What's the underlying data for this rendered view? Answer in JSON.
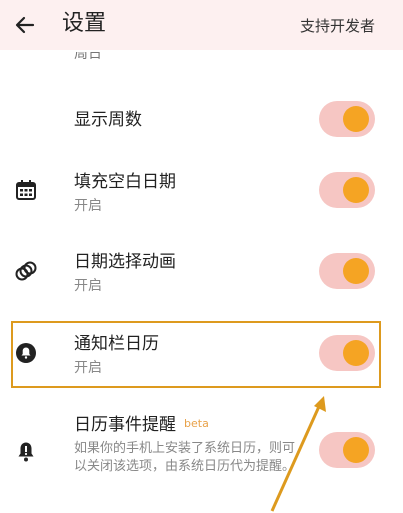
{
  "header": {
    "title": "设置",
    "action_label": "支持开发者"
  },
  "clipped_prev_subtitle": "周日",
  "settings": [
    {
      "title": "显示周数",
      "subtitle": "",
      "toggle_on": true
    },
    {
      "title": "填充空白日期",
      "subtitle": "开启",
      "icon": "calendar-grid-icon",
      "toggle_on": true
    },
    {
      "title": "日期选择动画",
      "subtitle": "开启",
      "icon": "rings-icon",
      "toggle_on": true
    },
    {
      "title": "通知栏日历",
      "subtitle": "开启",
      "icon": "bell-icon",
      "toggle_on": true
    },
    {
      "title": "日历事件提醒",
      "badge": "beta",
      "description": "如果你的手机上安装了系统日历，则可以关闭该选项，由系统日历代为提醒。",
      "icon": "bell-alert-icon",
      "toggle_on": true
    }
  ],
  "colors": {
    "header_bg": "#fdf0f0",
    "toggle_track": "#f6c6c3",
    "toggle_thumb": "#f5a423",
    "highlight": "#dd9a1e"
  }
}
